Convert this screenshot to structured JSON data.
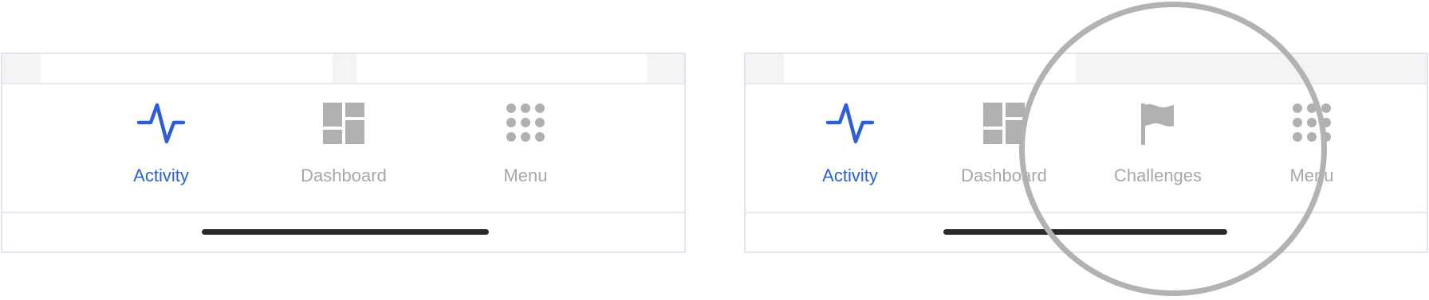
{
  "left_panel": {
    "tabs": [
      {
        "label": "Activity",
        "icon": "activity-pulse-icon",
        "active": true
      },
      {
        "label": "Dashboard",
        "icon": "dashboard-grid-icon",
        "active": false
      },
      {
        "label": "Menu",
        "icon": "menu-dots-icon",
        "active": false
      }
    ]
  },
  "right_panel": {
    "tabs": [
      {
        "label": "Activity",
        "icon": "activity-pulse-icon",
        "active": true
      },
      {
        "label": "Dashboard",
        "icon": "dashboard-grid-icon",
        "active": false
      },
      {
        "label": "Challenges",
        "icon": "flag-icon",
        "active": false
      },
      {
        "label": "Menu",
        "icon": "menu-dots-icon",
        "active": false
      }
    ]
  },
  "colors": {
    "active": "#2b5fd8",
    "inactive": "#a8a8a8",
    "icon_inactive": "#b0b0b0",
    "border": "#dfe6f2",
    "home_indicator": "#2a2a2a",
    "highlight_ring": "#b3b1b1"
  }
}
